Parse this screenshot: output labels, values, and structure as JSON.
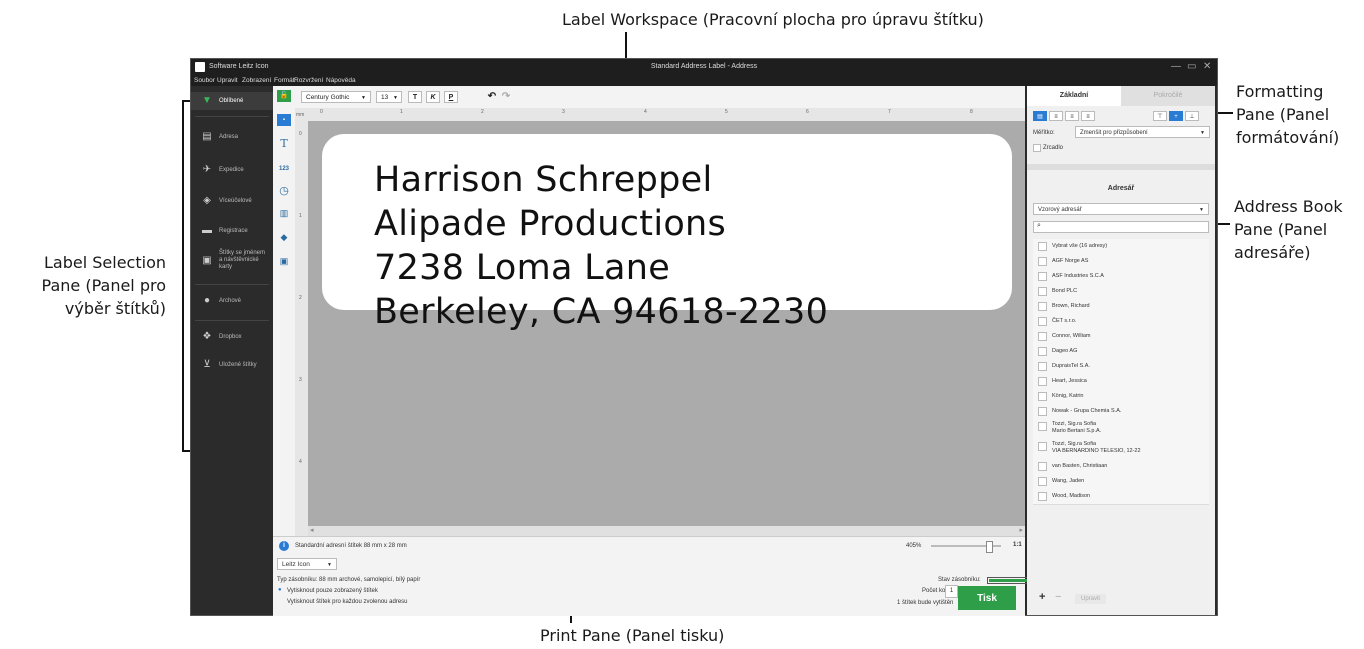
{
  "annotations": {
    "workspace": "Label Workspace (Pracovní plocha pro úpravu štítku)",
    "formatting": [
      "Formatting",
      "Pane (Panel",
      "formátování)"
    ],
    "addressbook": [
      "Address Book",
      "Pane (Panel",
      "adresáře)"
    ],
    "selection": [
      "Label Selection",
      "Pane (Panel pro",
      "výběr štítků)"
    ],
    "print": "Print Pane (Panel tisku)"
  },
  "window": {
    "app_name": "Software Leitz Icon",
    "title": "Standard Address Label - Address",
    "min_glyph": "—",
    "max_glyph": "▭",
    "close_glyph": "✕"
  },
  "menu": [
    "Soubor",
    "Upravit",
    "Zobrazení",
    "Formát",
    "Rozvržení",
    "Nápověda"
  ],
  "sidebar": {
    "items": [
      {
        "label": "Oblíbené"
      },
      {
        "label": "Adresa"
      },
      {
        "label": "Expedice"
      },
      {
        "label": "Víceúčelové"
      },
      {
        "label": "Registrace"
      },
      {
        "label": "Štítky se jménem a návštěvnické karty"
      },
      {
        "label": "Archové"
      },
      {
        "label": "Dropbox"
      },
      {
        "label": "Uložené štítky"
      }
    ]
  },
  "toolbar": {
    "font": "Century Gothic",
    "size": "13",
    "bold": "T",
    "italic": "K",
    "underline": "P",
    "undo": "↶",
    "redo": "↷"
  },
  "tools": {
    "lock": "🔓",
    "text": "T",
    "counter": "123",
    "clock": "◷",
    "barcode": "▥",
    "shape": "◆",
    "image": "▣"
  },
  "ruler": {
    "unit": "mm",
    "h_marks": [
      "0",
      "1",
      "2",
      "3",
      "4",
      "5",
      "6",
      "7",
      "8"
    ],
    "v_marks": [
      "0",
      "1",
      "2",
      "3",
      "4"
    ]
  },
  "label": {
    "lines": [
      "Harrison Schreppel",
      "Alipade Productions",
      "7238 Loma Lane",
      "Berkeley, CA 94618-2230"
    ]
  },
  "print": {
    "info": "Standardní adresní štítek 88 mm x 28 mm",
    "zoom": "405%",
    "zoom_fit": "1:1",
    "printer": "Leitz Icon",
    "cartridge_type": "Typ zásobníku: 88 mm archové, samolepicí, bílý papír",
    "cartridge_status": "Stav zásobníku:",
    "option1": "Vytisknout pouze zobrazený štítek",
    "option2": "Vytisknout štítek pro každou zvolenou adresu",
    "copies_label": "Počet kopií:",
    "copies": "1",
    "will_print": "1 štítek bude vytištěn",
    "print_button": "Tisk"
  },
  "right": {
    "tab_basic": "Základní",
    "tab_advanced": "Pokročilé",
    "scale_label": "Měřítko:",
    "scale_value": "Zmenšit pro přizpůsobení",
    "mirror": "Zrcadlo",
    "addressbook_title": "Adresář",
    "addressbook_select": "Vzorový adresář",
    "rows": [
      "Vybrat vše (16 adresy)",
      "AGF Norge AS",
      "ASF Industries S.C.A",
      "Bond PLC",
      "Brown, Richard",
      "ČET s.r.o.",
      "Connor, William",
      "Dageo AG",
      "DupraisTel S.A.",
      "Heart, Jessica",
      "König, Katrin",
      "Nowak - Grupa Chemia S.A.",
      "Tozzi, Sig.ra Sofia\nMario Bertani S.p.A.",
      "Tozzi, Sig.ra Sofia\nVIA BERNARDINO TELESIO, 12-22",
      "van Basten, Christiaan",
      "Wang, Jaden",
      "Wood, Madison"
    ],
    "add": "+",
    "remove": "−",
    "edit": "Upravit"
  }
}
